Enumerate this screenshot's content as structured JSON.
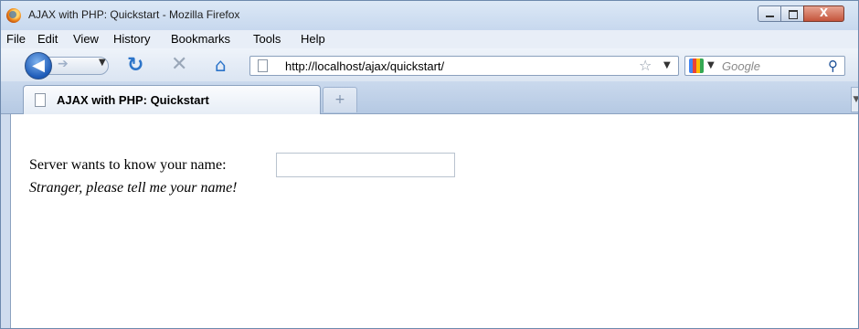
{
  "window": {
    "title": "AJAX with PHP: Quickstart - Mozilla Firefox",
    "close_glyph": "X"
  },
  "menu": [
    {
      "label": "File"
    },
    {
      "label": "Edit"
    },
    {
      "label": "View"
    },
    {
      "label": "History"
    },
    {
      "label": "Bookmarks"
    },
    {
      "label": "Tools"
    },
    {
      "label": "Help"
    }
  ],
  "navigation": {
    "url": "http://localhost/ajax/quickstart/",
    "search_placeholder": "Google",
    "icons": [
      "back-arrow-icon",
      "forward-arrow-icon",
      "reload-icon",
      "stop-icon",
      "home-icon",
      "page-icon",
      "bookmark-star-icon",
      "google-icon",
      "magnifier-icon"
    ]
  },
  "tabs": [
    {
      "label": "AJAX with PHP: Quickstart",
      "active": true
    }
  ],
  "content": {
    "prompt": "Server wants to know your name:",
    "input_value": "",
    "message": "Stranger, please tell me your name!"
  },
  "colors": {
    "accent": "#2c74c9",
    "chrome": "#cfdcee"
  }
}
